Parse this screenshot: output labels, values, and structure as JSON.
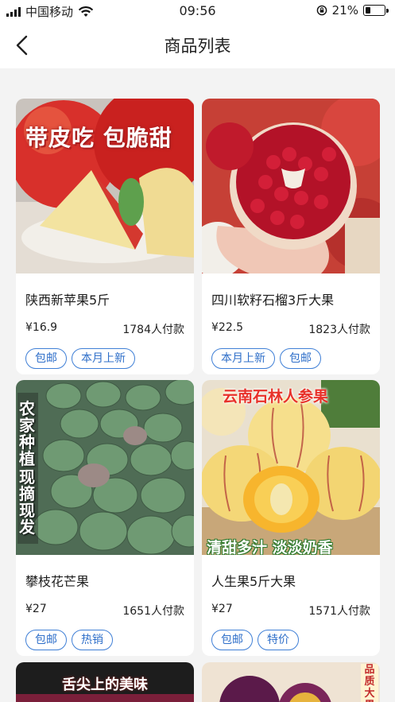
{
  "status_bar": {
    "carrier": "中国移动",
    "time": "09:56",
    "battery": "21%"
  },
  "nav": {
    "title": "商品列表"
  },
  "products": [
    {
      "name": "陕西新苹果5斤",
      "price": "¥16.9",
      "sales": "1784人付款",
      "tags": [
        "包邮",
        "本月上新"
      ],
      "image_text": "带皮吃 包脆甜"
    },
    {
      "name": "四川软籽石榴3斤大果",
      "price": "¥22.5",
      "sales": "1823人付款",
      "tags": [
        "本月上新",
        "包邮"
      ]
    },
    {
      "name": "攀枝花芒果",
      "price": "¥27",
      "sales": "1651人付款",
      "tags": [
        "包邮",
        "热销"
      ],
      "image_text_1": "农家种植",
      "image_text_2": "现摘现发"
    },
    {
      "name": "人生果5斤大果",
      "price": "¥27",
      "sales": "1571人付款",
      "tags": [
        "包邮",
        "特价"
      ],
      "image_text_1": "云南石林人参果",
      "image_text_2": "清甜多汁 淡淡奶香"
    },
    {
      "image_text": "舌尖上的美味"
    },
    {
      "image_text": "品质大果"
    }
  ]
}
